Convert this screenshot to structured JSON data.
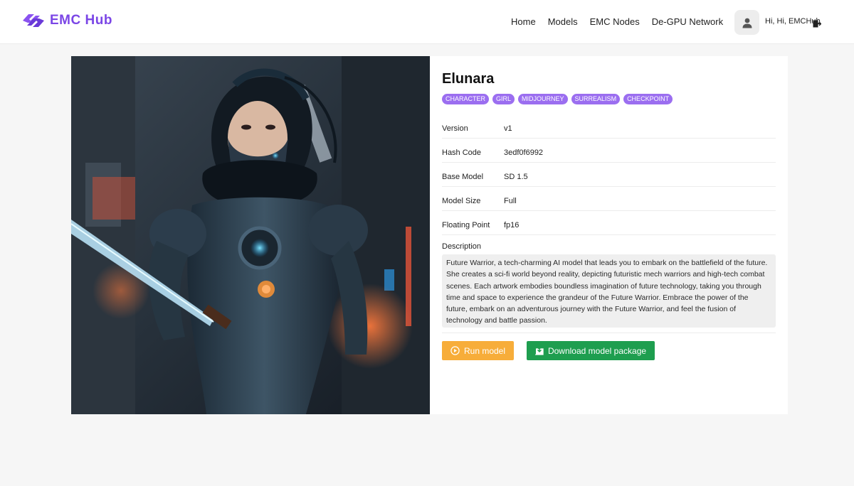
{
  "brand": {
    "name": "EMC Hub",
    "color": "#7b46e6"
  },
  "nav": {
    "items": [
      "Home",
      "Models",
      "EMC Nodes",
      "De-GPU Network"
    ]
  },
  "user": {
    "greeting": "Hi, Hi, EMCHub",
    "avatar_icon": "user-icon",
    "logout_icon": "logout-icon"
  },
  "model": {
    "title": "Elunara",
    "tags": [
      "CHARACTER",
      "GIRL",
      "MIDJOURNEY",
      "SURREALISM",
      "CHECKPOINT"
    ],
    "details": [
      {
        "label": "Version",
        "value": "v1"
      },
      {
        "label": "Hash Code",
        "value": "3edf0f6992"
      },
      {
        "label": "Base Model",
        "value": "SD 1.5"
      },
      {
        "label": "Model Size",
        "value": "Full"
      },
      {
        "label": "Floating Point",
        "value": "fp16"
      }
    ],
    "description_label": "Description",
    "description": "Future Warrior, a tech-charming AI model that leads you to embark on the battlefield of the future. She creates a sci-fi world beyond reality, depicting futuristic mech warriors and high-tech combat scenes. Each artwork embodies boundless imagination of future technology, taking you through time and space to experience the grandeur of the Future Warrior. Embrace the power of the future, embark on an adventurous journey with the Future Warrior, and feel the fusion of technology and battle passion."
  },
  "actions": {
    "run_label": "Run model",
    "run_icon": "play-circle-icon",
    "download_label": "Download model package",
    "download_icon": "download-icon",
    "run_color": "#f7ad3a",
    "download_color": "#1e9e4f"
  },
  "colors": {
    "tag_bg": "#9b6ef0",
    "page_bg": "#f6f6f6"
  }
}
